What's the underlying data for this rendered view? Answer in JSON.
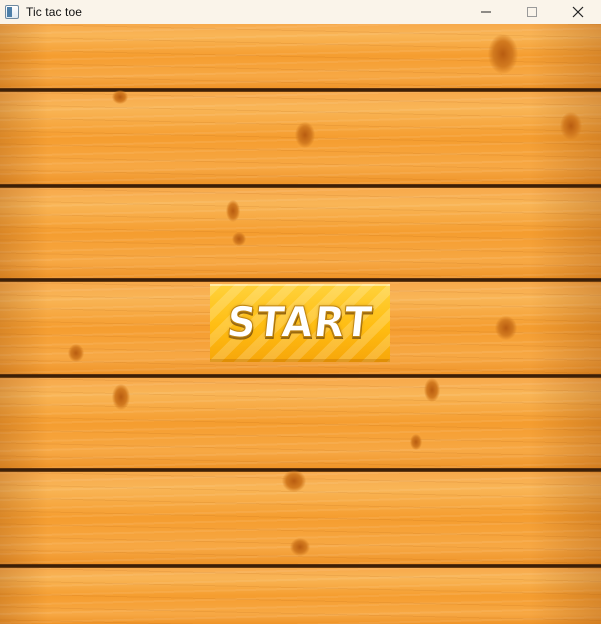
{
  "window": {
    "title": "Tic tac toe",
    "icon": "app-window-icon",
    "controls": [
      "minimize-icon",
      "maximize-icon",
      "close-icon"
    ]
  },
  "game": {
    "start_label": "START",
    "colors": {
      "wood": "#f59d2f",
      "gap": "#2a1404",
      "button_top": "#ffd23b",
      "button_bottom": "#f7a60a",
      "button_text": "#ffffff"
    }
  }
}
